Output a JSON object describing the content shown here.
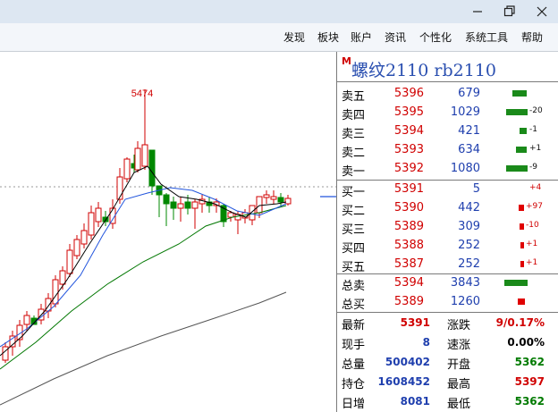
{
  "window": {
    "minimize_icon": "minimize-icon",
    "restore_icon": "restore-icon",
    "close_icon": "close-icon"
  },
  "menu": [
    "发现",
    "板块",
    "账户",
    "资讯",
    "个性化",
    "系统工具",
    "帮助"
  ],
  "chart": {
    "peak_label": "5474",
    "colors": {
      "up": "#d00000",
      "down": "#008800",
      "ma_fast": "#000000",
      "ma_mid": "#2255dd",
      "ma_slow": "#007700",
      "ma_long": "#555555"
    }
  },
  "quote": {
    "badge": "M",
    "name": "螺纹2110",
    "code": "rb2110",
    "ask": [
      {
        "label": "卖五",
        "price": "5396",
        "volume": "679",
        "change": "",
        "bar": 0.4
      },
      {
        "label": "卖四",
        "price": "5395",
        "volume": "1029",
        "change": "-20",
        "bar": 0.6
      },
      {
        "label": "卖三",
        "price": "5394",
        "volume": "421",
        "change": "-1",
        "bar": 0.3
      },
      {
        "label": "卖二",
        "price": "5393",
        "volume": "634",
        "change": "+1",
        "bar": 0.35
      },
      {
        "label": "卖一",
        "price": "5392",
        "volume": "1080",
        "change": "-9",
        "bar": 0.6
      }
    ],
    "bid": [
      {
        "label": "买一",
        "price": "5391",
        "volume": "5",
        "change": "+4",
        "bar": 0.0
      },
      {
        "label": "买二",
        "price": "5390",
        "volume": "442",
        "change": "+97",
        "bar": 0.15
      },
      {
        "label": "买三",
        "price": "5389",
        "volume": "309",
        "change": "-10",
        "bar": 0.12
      },
      {
        "label": "买四",
        "price": "5388",
        "volume": "252",
        "change": "+1",
        "bar": 0.1
      },
      {
        "label": "买五",
        "price": "5387",
        "volume": "252",
        "change": "+1",
        "bar": 0.1
      }
    ],
    "total_ask": {
      "label": "总卖",
      "price": "5394",
      "volume": "3843",
      "bar": 0.7
    },
    "total_bid": {
      "label": "总买",
      "price": "5389",
      "volume": "1260",
      "bar": 0.2
    },
    "stats": [
      {
        "k1": "最新",
        "v1": "5391",
        "c1": "red",
        "k2": "涨跌",
        "v2": "9/0.17%",
        "c2": "red"
      },
      {
        "k1": "现手",
        "v1": "8",
        "c1": "blue",
        "k2": "速涨",
        "v2": "0.00%",
        "c2": "black"
      },
      {
        "k1": "总量",
        "v1": "500402",
        "c1": "blue",
        "k2": "开盘",
        "v2": "5362",
        "c2": "green"
      },
      {
        "k1": "持仓",
        "v1": "1608452",
        "c1": "blue",
        "k2": "最高",
        "v2": "5397",
        "c2": "red"
      },
      {
        "k1": "日增",
        "v1": "8081",
        "c1": "blue",
        "k2": "最低",
        "v2": "5362",
        "c2": "green"
      }
    ]
  }
}
